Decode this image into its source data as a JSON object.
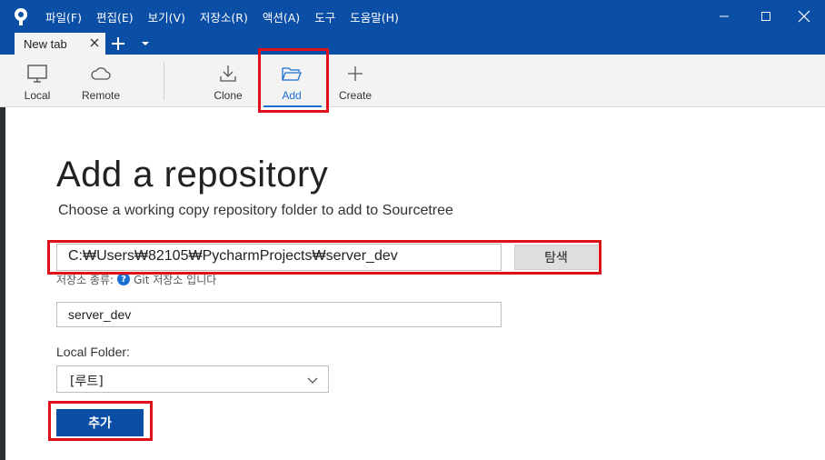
{
  "titlebar": {
    "menu": [
      "파일(F)",
      "편집(E)",
      "보기(V)",
      "저장소(R)",
      "액션(A)",
      "도구",
      "도움말(H)"
    ]
  },
  "tabs": {
    "active_label": "New tab"
  },
  "toolbar": {
    "local": "Local",
    "remote": "Remote",
    "clone": "Clone",
    "add": "Add",
    "create": "Create"
  },
  "main": {
    "title": "Add a repository",
    "subtitle": "Choose a working copy repository folder to add to Sourcetree",
    "path_value": "C:₩Users₩82105₩PycharmProjects₩server_dev",
    "browse_label": "탐색",
    "repo_type_label": "저장소 종류:",
    "repo_type_value": "Git 저장소 입니다",
    "name_value": "server_dev",
    "local_folder_label": "Local Folder:",
    "local_folder_selected": "[루트]",
    "submit_label": "추가"
  },
  "colors": {
    "titlebar": "#0a4ea6",
    "accent": "#1a6fd1",
    "highlight": "#e0101a"
  }
}
